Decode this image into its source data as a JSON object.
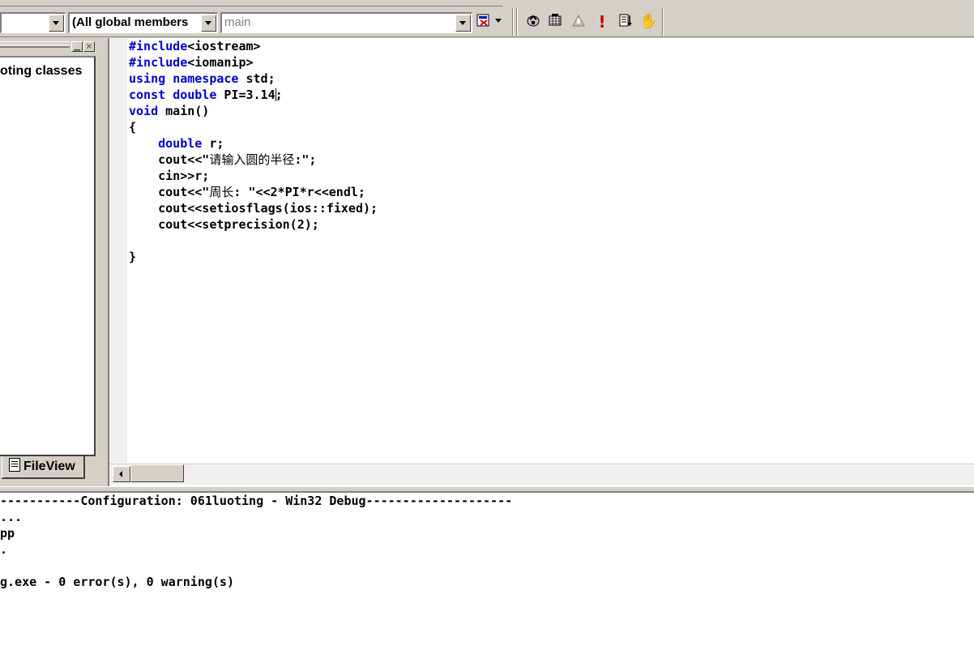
{
  "toolbar": {
    "class_combo_value": "",
    "members_combo_value": "(All global members",
    "function_combo_value": "main",
    "icons": [
      "wizard-bar-actions-icon",
      "wizard-dropdown-icon",
      "compile-icon",
      "build-icon",
      "stop-build-icon",
      "execute-icon",
      "go-icon",
      "insert-breakpoint-icon"
    ],
    "execute_glyph": "!",
    "hand_glyph": "✋"
  },
  "workspace": {
    "tree_item": "oting classes",
    "tab_label": "FileView",
    "minimize_glyph": "▁",
    "close_glyph": "×"
  },
  "editor": {
    "lines": [
      {
        "parts": [
          {
            "t": "#include",
            "k": true
          },
          {
            "t": "<iostream>",
            "k": false
          }
        ]
      },
      {
        "parts": [
          {
            "t": "#include",
            "k": true
          },
          {
            "t": "<iomanip>",
            "k": false
          }
        ]
      },
      {
        "parts": [
          {
            "t": "using",
            "k": true
          },
          {
            "t": " ",
            "k": false
          },
          {
            "t": "namespace",
            "k": true
          },
          {
            "t": " std;",
            "k": false
          }
        ]
      },
      {
        "parts": [
          {
            "t": "const",
            "k": true
          },
          {
            "t": " ",
            "k": false
          },
          {
            "t": "double",
            "k": true
          },
          {
            "t": " PI=3.14",
            "k": false
          },
          {
            "caret": true
          },
          {
            "t": ";",
            "k": false
          }
        ]
      },
      {
        "parts": [
          {
            "t": "void",
            "k": true
          },
          {
            "t": " main()",
            "k": false
          }
        ]
      },
      {
        "parts": [
          {
            "t": "{",
            "k": false
          }
        ]
      },
      {
        "parts": [
          {
            "t": "    ",
            "k": false
          },
          {
            "t": "double",
            "k": true
          },
          {
            "t": " r;",
            "k": false
          }
        ]
      },
      {
        "parts": [
          {
            "t": "    cout<<\"",
            "k": false
          },
          {
            "t": "请输入圆的半径",
            "k": false,
            "cn": true
          },
          {
            "t": ":\";",
            "k": false
          }
        ]
      },
      {
        "parts": [
          {
            "t": "    cin>>r;",
            "k": false
          }
        ]
      },
      {
        "parts": [
          {
            "t": "    cout<<\"",
            "k": false
          },
          {
            "t": "周长",
            "k": false,
            "cn": true
          },
          {
            "t": ": \"<<2*PI*r<<endl;",
            "k": false
          }
        ]
      },
      {
        "parts": [
          {
            "t": "    cout<<setiosflags(ios::fixed);",
            "k": false
          }
        ]
      },
      {
        "parts": [
          {
            "t": "    cout<<setprecision(2);",
            "k": false
          }
        ]
      },
      {
        "parts": [
          {
            "t": "",
            "k": false
          }
        ]
      },
      {
        "parts": [
          {
            "t": "}",
            "k": false
          }
        ]
      }
    ]
  },
  "output": {
    "lines": [
      "-----------Configuration: 061luoting - Win32 Debug--------------------",
      "...",
      "pp",
      ".",
      "",
      "g.exe - 0 error(s), 0 warning(s)"
    ]
  }
}
